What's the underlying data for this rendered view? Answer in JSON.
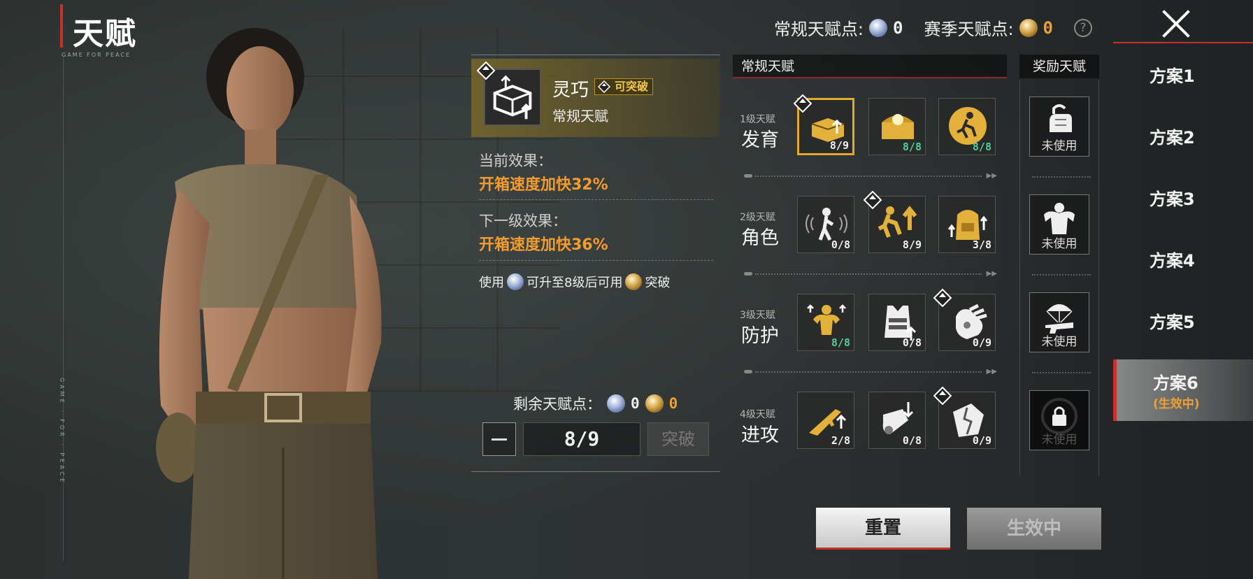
{
  "header": {
    "title": "天赋",
    "subtitle": "GAME FOR PEACE",
    "side_text": "GAME · FOR · PEACE",
    "regular_points_label": "常规天赋点:",
    "regular_points_value": "0",
    "season_points_label": "赛季天赋点:",
    "season_points_value": "0",
    "help_icon": "?"
  },
  "plans": [
    {
      "label": "方案1"
    },
    {
      "label": "方案2"
    },
    {
      "label": "方案3"
    },
    {
      "label": "方案4"
    },
    {
      "label": "方案5"
    },
    {
      "label": "方案6",
      "status": "(生效中)"
    }
  ],
  "detail": {
    "name": "灵巧",
    "breakable_tag": "可突破",
    "type": "常规天赋",
    "current_label": "当前效果：",
    "current_value": "开箱速度加快32%",
    "next_label": "下一级效果：",
    "next_value": "开箱速度加快36%",
    "usage_part1": "使用",
    "usage_part2": "可升至8级后可用",
    "usage_part3": "突破",
    "remaining_label": "剩余天赋点：",
    "remaining_regular": "0",
    "remaining_season": "0",
    "level": "8/9",
    "break_button": "突破"
  },
  "regular": {
    "header": "常规天赋",
    "tiers": [
      {
        "sub": "1级天赋",
        "name": "发育",
        "cells": [
          {
            "icon": "crate-speed-icon",
            "count": "8/9",
            "full": false,
            "selected": true,
            "badge": true
          },
          {
            "icon": "supply-chest-icon",
            "count": "8/8",
            "full": true,
            "selected": false,
            "badge": false
          },
          {
            "icon": "running-soldier-icon",
            "count": "8/8",
            "full": true,
            "selected": false,
            "badge": false
          }
        ]
      },
      {
        "sub": "2级天赋",
        "name": "角色",
        "cells": [
          {
            "icon": "sound-stealth-icon",
            "count": "0/8",
            "full": false,
            "selected": false,
            "badge": false
          },
          {
            "icon": "sprint-boost-icon",
            "count": "8/9",
            "full": false,
            "selected": false,
            "badge": true
          },
          {
            "icon": "backpack-upgrade-icon",
            "count": "3/8",
            "full": false,
            "selected": false,
            "badge": false
          }
        ]
      },
      {
        "sub": "3级天赋",
        "name": "防护",
        "cells": [
          {
            "icon": "muscle-health-icon",
            "count": "8/8",
            "full": true,
            "selected": false,
            "badge": false
          },
          {
            "icon": "armor-vest-icon",
            "count": "0/8",
            "full": false,
            "selected": false,
            "badge": false
          },
          {
            "icon": "glove-grip-icon",
            "count": "0/9",
            "full": false,
            "selected": false,
            "badge": true
          }
        ]
      },
      {
        "sub": "4级天赋",
        "name": "进攻",
        "cells": [
          {
            "icon": "rifle-upgrade-icon",
            "count": "2/8",
            "full": false,
            "selected": false,
            "badge": false
          },
          {
            "icon": "grenade-drop-icon",
            "count": "0/8",
            "full": false,
            "selected": false,
            "badge": false
          },
          {
            "icon": "shield-break-icon",
            "count": "0/9",
            "full": false,
            "selected": false,
            "badge": true
          }
        ]
      }
    ]
  },
  "bonus": {
    "header": "奖励天赋",
    "items": [
      {
        "icon": "unlocked-fist-icon",
        "label": "未使用",
        "locked": false
      },
      {
        "icon": "bodybuilder-icon",
        "label": "未使用",
        "locked": false
      },
      {
        "icon": "parachute-gun-icon",
        "label": "未使用",
        "locked": false
      },
      {
        "icon": "padlock-icon",
        "label": "未使用",
        "locked": true
      }
    ]
  },
  "buttons": {
    "reset": "重置",
    "active": "生效中"
  },
  "colors": {
    "accent_red": "#c8302c",
    "gold": "#e3a92a",
    "orange_text": "#f39c2e",
    "green_count": "#4fcf9a"
  }
}
